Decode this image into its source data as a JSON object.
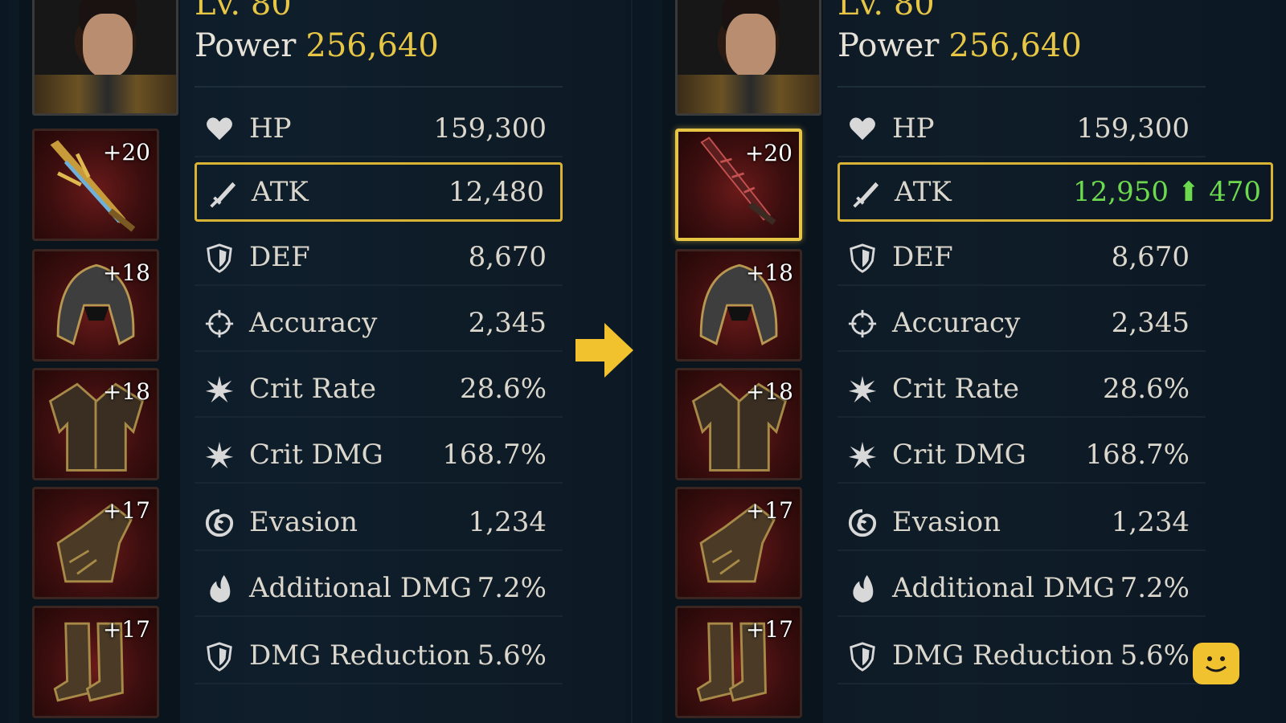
{
  "arrow_color": "#f2c12e",
  "highlight_color": "#e7c545",
  "increase_color": "#6dd94f",
  "before": {
    "level": "Lv. 80",
    "power_label": "Power",
    "power_value": "256,640",
    "gear": [
      {
        "slot": "weapon",
        "level": "+20",
        "selected": false
      },
      {
        "slot": "helmet",
        "level": "+18"
      },
      {
        "slot": "chest",
        "level": "+18"
      },
      {
        "slot": "gloves",
        "level": "+17"
      },
      {
        "slot": "boots",
        "level": "+17"
      }
    ],
    "stats": [
      {
        "icon": "heart-icon",
        "name": "HP",
        "value": "159,300"
      },
      {
        "icon": "sword-icon",
        "name": "ATK",
        "value": "12,480",
        "highlighted": true
      },
      {
        "icon": "shield-icon",
        "name": "DEF",
        "value": "8,670"
      },
      {
        "icon": "crosshair-icon",
        "name": "Accuracy",
        "value": "2,345"
      },
      {
        "icon": "star-burst-icon",
        "name": "Crit Rate",
        "value": "28.6%"
      },
      {
        "icon": "star-burst-icon",
        "name": "Crit DMG",
        "value": "168.7%"
      },
      {
        "icon": "swirl-icon",
        "name": "Evasion",
        "value": "1,234"
      },
      {
        "icon": "flame-icon",
        "name": "Additional DMG",
        "value": "7.2%"
      },
      {
        "icon": "shield-icon",
        "name": "DMG Reduction",
        "value": "5.6%"
      }
    ]
  },
  "after": {
    "level": "Lv. 80",
    "power_label": "Power",
    "power_value": "256,640",
    "gear": [
      {
        "slot": "weapon",
        "level": "+20",
        "selected": true
      },
      {
        "slot": "helmet",
        "level": "+18"
      },
      {
        "slot": "chest",
        "level": "+18"
      },
      {
        "slot": "gloves",
        "level": "+17"
      },
      {
        "slot": "boots",
        "level": "+17"
      }
    ],
    "stats": [
      {
        "icon": "heart-icon",
        "name": "HP",
        "value": "159,300"
      },
      {
        "icon": "sword-icon",
        "name": "ATK",
        "value": "12,950 ⬆ 470",
        "highlighted": true
      },
      {
        "icon": "shield-icon",
        "name": "DEF",
        "value": "8,670"
      },
      {
        "icon": "crosshair-icon",
        "name": "Accuracy",
        "value": "2,345"
      },
      {
        "icon": "star-burst-icon",
        "name": "Crit Rate",
        "value": "28.6%"
      },
      {
        "icon": "star-burst-icon",
        "name": "Crit DMG",
        "value": "168.7%"
      },
      {
        "icon": "swirl-icon",
        "name": "Evasion",
        "value": "1,234"
      },
      {
        "icon": "flame-icon",
        "name": "Additional DMG",
        "value": "7.2%"
      },
      {
        "icon": "shield-icon",
        "name": "DMG Reduction",
        "value": "5.6%"
      }
    ]
  },
  "chat_button_icon": "smiley-chat-icon"
}
